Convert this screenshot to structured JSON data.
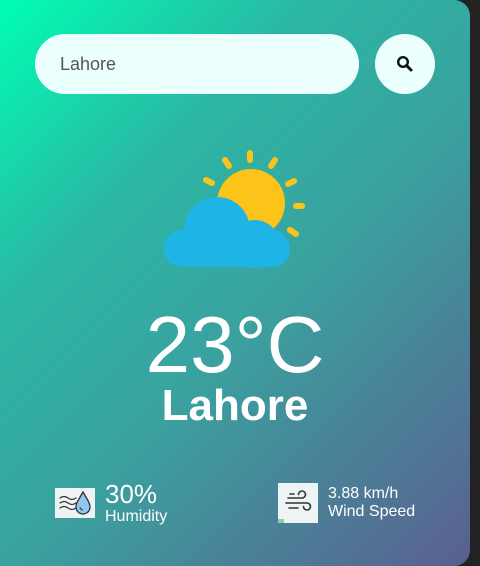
{
  "search": {
    "value": "Lahore",
    "button_icon": "search-icon"
  },
  "weather": {
    "icon": "partly-cloudy-icon",
    "temperature": "23°C",
    "city": "Lahore"
  },
  "details": {
    "humidity": {
      "icon": "humidity-icon",
      "value": "30%",
      "label": "Humidity"
    },
    "wind": {
      "icon": "wind-icon",
      "value": "3.88 km/h",
      "label": "Wind Speed"
    }
  },
  "colors": {
    "gradient_start": "#00ffb4",
    "gradient_end": "#5a5f90",
    "sun": "#fcc419",
    "cloud": "#1eb4e6",
    "input_bg": "#ebfffc"
  }
}
